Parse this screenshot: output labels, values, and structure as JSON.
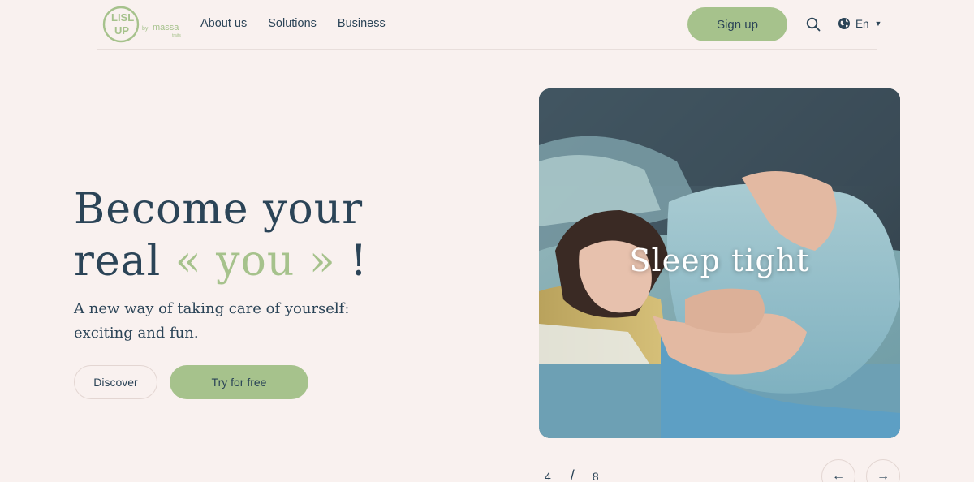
{
  "logo": {
    "line1": "LISL",
    "line2": "UP",
    "by": "by",
    "brand": "massa",
    "brand_sub": "traits"
  },
  "nav": {
    "items": [
      {
        "label": "About us"
      },
      {
        "label": "Solutions"
      },
      {
        "label": "Business"
      }
    ],
    "signup_label": "Sign up",
    "search_icon": "search-icon",
    "language": "En"
  },
  "hero": {
    "title_line1": "Become your",
    "title_line2_pre": "real",
    "title_accent": "« you »",
    "title_line2_post": "!",
    "subtitle": "A new way of taking care of yourself: exciting and fun.",
    "discover_label": "Discover",
    "try_label": "Try for free"
  },
  "slider": {
    "caption": "Sleep tight",
    "current": "4",
    "separator": "/",
    "total": "8",
    "prev_icon": "←",
    "next_icon": "→"
  },
  "colors": {
    "background": "#f9f1ef",
    "primary_text": "#2b4457",
    "accent": "#a6c28c"
  }
}
